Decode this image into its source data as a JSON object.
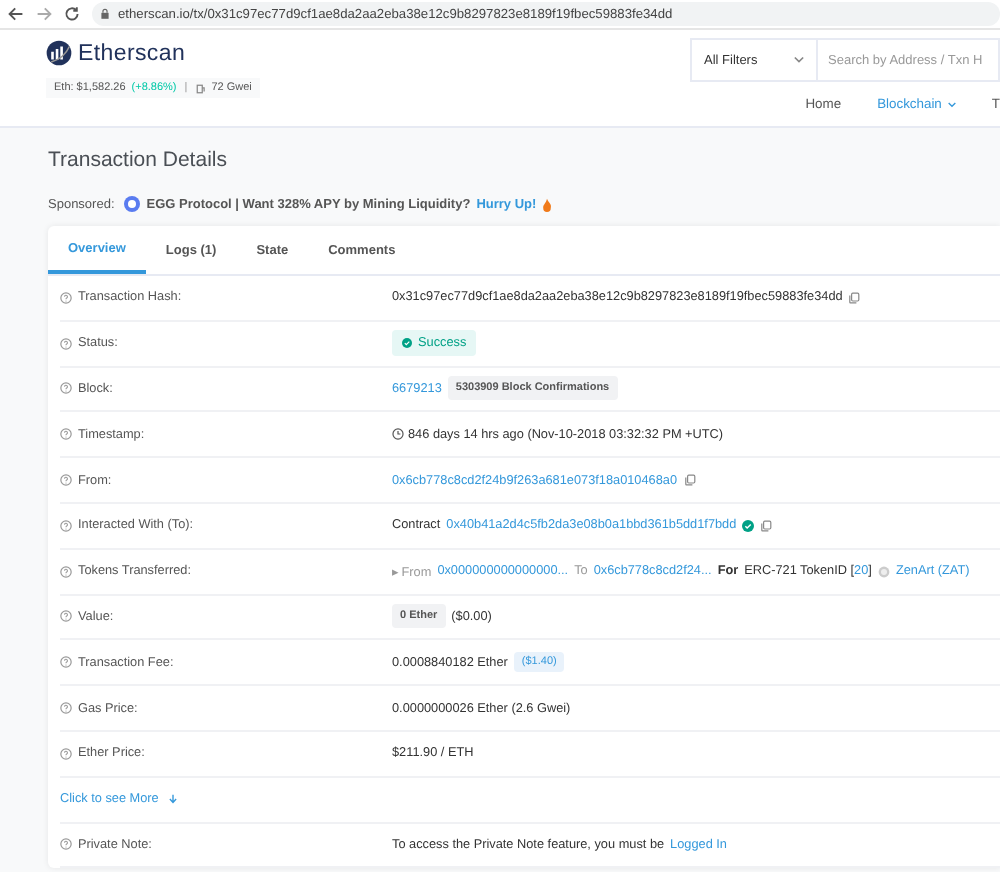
{
  "browser": {
    "url": "etherscan.io/tx/0x31c97ec77d9cf1ae8da2aa2eba38e12c9b8297823e8189f19fbec59883fe34dd"
  },
  "header": {
    "logo_text": "Etherscan",
    "eth_price": "Eth: $1,582.26",
    "eth_change": "(+8.86%)",
    "separator": "|",
    "gas": "72 Gwei",
    "filter": "All Filters",
    "search_placeholder": "Search by Address / Txn H",
    "nav": [
      {
        "label": "Home",
        "selected": false,
        "caret": false
      },
      {
        "label": "Blockchain",
        "selected": true,
        "caret": true
      },
      {
        "label": "T",
        "selected": false,
        "caret": false
      }
    ]
  },
  "page_title": "Transaction Details",
  "sponsored": {
    "label": "Sponsored:",
    "text": "EGG Protocol | Want 328% APY by Mining Liquidity?",
    "link": "Hurry Up!"
  },
  "tabs": [
    {
      "label": "Overview",
      "selected": true
    },
    {
      "label": "Logs (1)",
      "selected": false
    },
    {
      "label": "State",
      "selected": false
    },
    {
      "label": "Comments",
      "selected": false
    }
  ],
  "rows": [
    {
      "kind": "field",
      "label": "Transaction Hash:",
      "value": [
        {
          "kind": "text",
          "text": "0x31c97ec77d9cf1ae8da2aa2eba38e12c9b8297823e8189f19fbec59883fe34dd"
        },
        {
          "kind": "copy"
        }
      ]
    },
    {
      "kind": "field",
      "label": "Status:",
      "value": [
        {
          "kind": "success",
          "text": "Success"
        }
      ]
    },
    {
      "kind": "field",
      "label": "Block:",
      "value": [
        {
          "kind": "link",
          "text": "6679213"
        },
        {
          "kind": "pill",
          "text": "5303909 Block Confirmations"
        }
      ]
    },
    {
      "kind": "field",
      "label": "Timestamp:",
      "value": [
        {
          "kind": "clock"
        },
        {
          "kind": "text",
          "text": "846 days 14 hrs ago (Nov-10-2018 03:32:32 PM +UTC)"
        }
      ]
    },
    {
      "kind": "field",
      "label": "From:",
      "value": [
        {
          "kind": "link",
          "text": "0x6cb778c8cd2f24b9f263a681e073f18a010468a0"
        },
        {
          "kind": "copy"
        }
      ]
    },
    {
      "kind": "field",
      "label": "Interacted With (To):",
      "value": [
        {
          "kind": "text",
          "text": "Contract"
        },
        {
          "kind": "link",
          "text": "0x40b41a2d4c5fb2da3e08b0a1bbd361b5dd1f7bdd"
        },
        {
          "kind": "check"
        },
        {
          "kind": "copy"
        }
      ]
    },
    {
      "kind": "field",
      "label": "Tokens Transferred:",
      "value": [
        {
          "kind": "muted",
          "text": "▸ From"
        },
        {
          "kind": "link",
          "text": "0x000000000000000..."
        },
        {
          "kind": "muted",
          "text": "To"
        },
        {
          "kind": "link",
          "text": "0x6cb778c8cd2f24..."
        },
        {
          "kind": "bold",
          "text": "For"
        },
        {
          "kind": "text",
          "text": "ERC-721 TokenID ["
        },
        {
          "kind": "tight_link",
          "text": "20"
        },
        {
          "kind": "tight_text",
          "text": "]"
        },
        {
          "kind": "token"
        },
        {
          "kind": "link",
          "text": "ZenArt (ZAT)"
        }
      ]
    },
    {
      "kind": "field",
      "label": "Value:",
      "value": [
        {
          "kind": "pill",
          "text": "0 Ether"
        },
        {
          "kind": "text",
          "text": "($0.00)"
        }
      ]
    },
    {
      "kind": "field",
      "label": "Transaction Fee:",
      "value": [
        {
          "kind": "text",
          "text": "0.0008840182 Ether"
        },
        {
          "kind": "fee",
          "text": "($1.40)"
        }
      ]
    },
    {
      "kind": "field",
      "label": "Gas Price:",
      "value": [
        {
          "kind": "text",
          "text": "0.0000000026 Ether (2.6 Gwei)"
        }
      ]
    },
    {
      "kind": "field",
      "label": "Ether Price:",
      "value": [
        {
          "kind": "text",
          "text": "$211.90 / ETH"
        }
      ]
    },
    {
      "kind": "more",
      "label": "Click to see More"
    },
    {
      "kind": "field",
      "label": "Private Note:",
      "value": [
        {
          "kind": "text",
          "text": "To access the Private Note feature, you must be"
        },
        {
          "kind": "link",
          "text": "Logged In"
        }
      ]
    }
  ]
}
